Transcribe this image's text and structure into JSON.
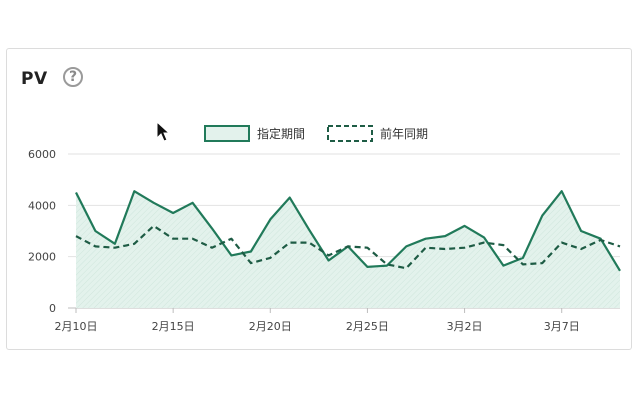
{
  "panel": {
    "title": "PV",
    "help_icon": "question-circle-icon",
    "help_glyph": "?"
  },
  "chart_data": {
    "type": "line",
    "title": "",
    "xlabel": "",
    "ylabel": "",
    "ylim": [
      0,
      6000
    ],
    "yticks": [
      0,
      2000,
      4000,
      6000
    ],
    "grid": true,
    "legend_position": "top-center",
    "x": [
      "2月10日",
      "2月11日",
      "2月12日",
      "2月13日",
      "2月14日",
      "2月15日",
      "2月16日",
      "2月17日",
      "2月18日",
      "2月19日",
      "2月20日",
      "2月21日",
      "2月22日",
      "2月23日",
      "2月24日",
      "2月25日",
      "2月26日",
      "2月27日",
      "2月28日",
      "3月1日",
      "3月2日",
      "3月3日",
      "3月4日",
      "3月5日",
      "3月6日",
      "3月7日",
      "3月8日",
      "3月9日",
      "3月10日"
    ],
    "xtick_labels": [
      "2月10日",
      "2月15日",
      "2月20日",
      "2月25日",
      "3月2日",
      "3月7日"
    ],
    "series": [
      {
        "name": "指定期間",
        "style": "solid-area",
        "color": "#217a5a",
        "fill": "#e3f2ec",
        "values": [
          4500,
          3000,
          2500,
          4550,
          4100,
          3700,
          4100,
          3100,
          2050,
          2200,
          3450,
          4300,
          3050,
          1850,
          2400,
          1600,
          1650,
          2400,
          2700,
          2800,
          3200,
          2750,
          1650,
          1950,
          3600,
          4550,
          3000,
          2700,
          1450
        ]
      },
      {
        "name": "前年同期",
        "style": "dashed",
        "color": "#1e5c45",
        "values": [
          2800,
          2400,
          2350,
          2500,
          3200,
          2700,
          2700,
          2350,
          2700,
          1750,
          1950,
          2550,
          2550,
          2050,
          2400,
          2350,
          1700,
          1550,
          2350,
          2300,
          2350,
          2550,
          2450,
          1700,
          1750,
          2550,
          2300,
          2650,
          2400
        ]
      }
    ]
  }
}
